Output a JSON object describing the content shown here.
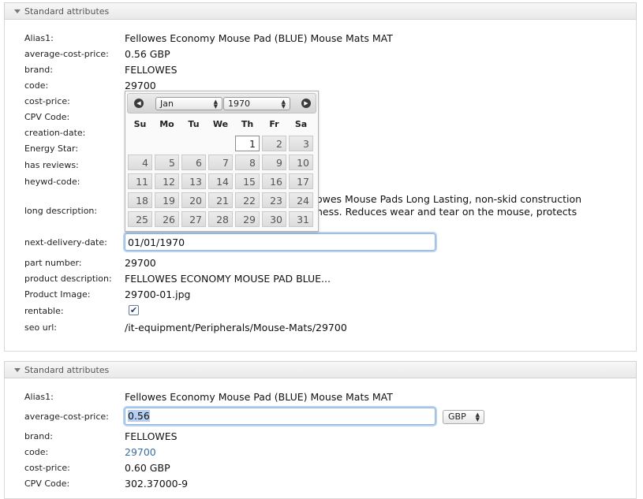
{
  "panel_title": "Standard attributes",
  "section1": {
    "rows": [
      {
        "label": "Alias1:",
        "value": "Fellowes Economy Mouse Pad (BLUE) Mouse Mats MAT"
      },
      {
        "label": "average-cost-price:",
        "value": "0.56 GBP"
      },
      {
        "label": "brand:",
        "value": "FELLOWES"
      },
      {
        "label": "code:",
        "value": "29700"
      },
      {
        "label": "cost-price:",
        "value": ""
      },
      {
        "label": "CPV Code:",
        "value": ""
      },
      {
        "label": "creation-date:",
        "value": ""
      },
      {
        "label": "Energy Star:",
        "value": ""
      },
      {
        "label": "has reviews:",
        "value": ""
      },
      {
        "label": "heywd-code:",
        "value": ""
      }
    ],
    "long_description": {
      "label": "long description:",
      "line1": "owes Mouse Pads Long Lasting, non-skid construction",
      "line2": "ness. Reduces wear and tear on the mouse, protects"
    },
    "next_delivery_date": {
      "label": "next-delivery-date:",
      "value": "01/01/1970"
    },
    "part_number": {
      "label": "part number:",
      "value": "29700"
    },
    "product_description": {
      "label": "product description:",
      "value": "FELLOWES ECONOMY MOUSE PAD BLUE..."
    },
    "product_image": {
      "label": "Product Image:",
      "value": "29700-01.jpg"
    },
    "rentable": {
      "label": "rentable:",
      "checked": true,
      "mark": "✔"
    },
    "seo_url": {
      "label": "seo url:",
      "value": "/it-equipment/Peripherals/Mouse-Mats/29700"
    }
  },
  "datepicker": {
    "prev_icon": "◀",
    "next_icon": "▶",
    "month": "Jan",
    "year": "1970",
    "days_of_week": [
      "Su",
      "Mo",
      "Tu",
      "We",
      "Th",
      "Fr",
      "Sa"
    ],
    "first_weekday": 4,
    "days_in_month": 31,
    "selected_day": 1
  },
  "section2": {
    "alias1": {
      "label": "Alias1:",
      "value": "Fellowes Economy Mouse Pad (BLUE) Mouse Mats MAT"
    },
    "average_cost_price": {
      "label": "average-cost-price:",
      "value": "0.56",
      "currency": "GBP"
    },
    "brand": {
      "label": "brand:",
      "value": "FELLOWES"
    },
    "code": {
      "label": "code:",
      "value": "29700"
    },
    "cost_price": {
      "label": "cost-price:",
      "value": "0.60 GBP"
    },
    "cpv_code": {
      "label": "CPV Code:",
      "value": "302.37000-9"
    }
  }
}
